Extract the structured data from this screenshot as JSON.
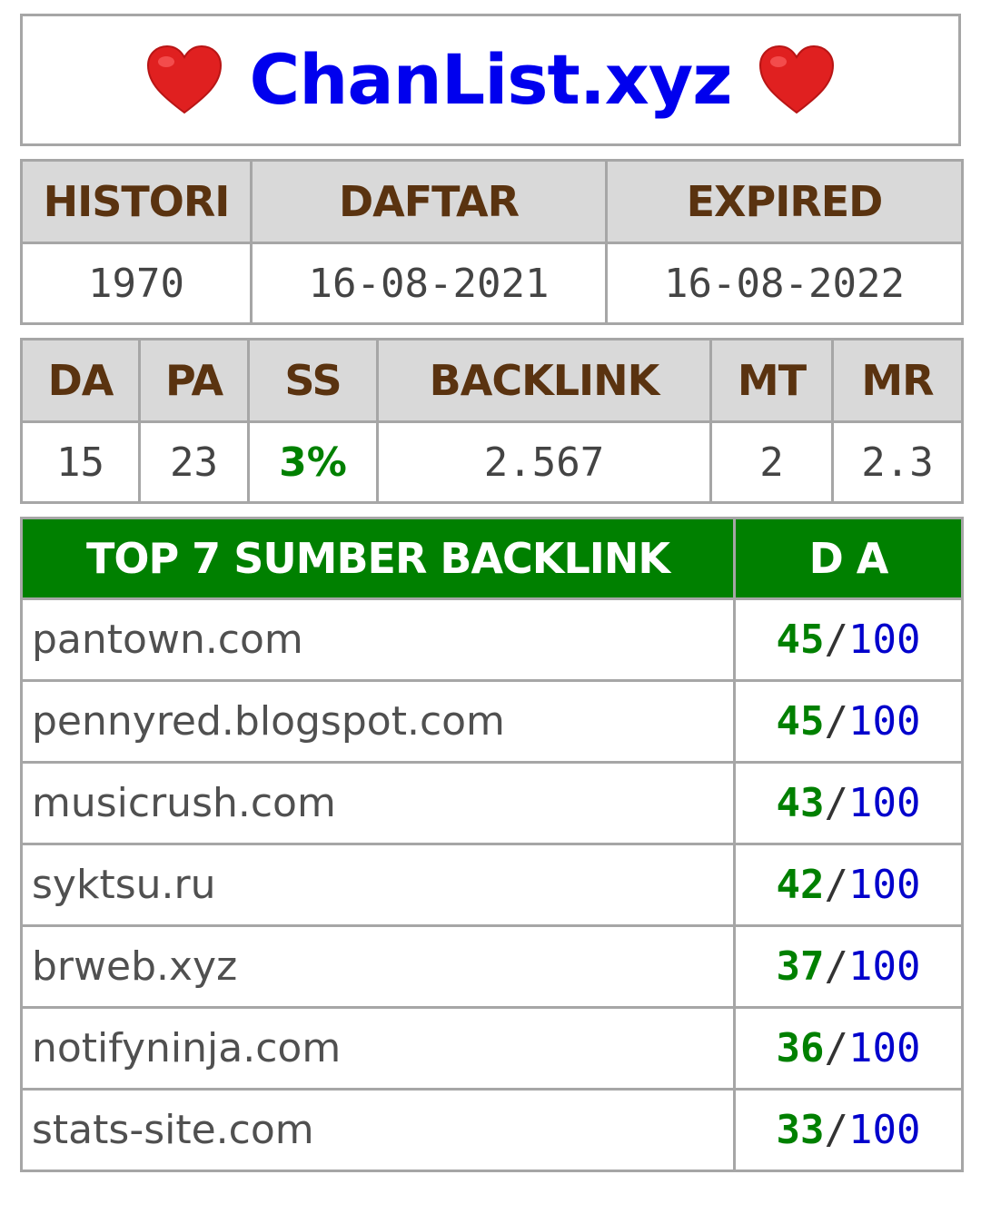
{
  "title": {
    "text": "ChanList.xyz",
    "left_icon": "heart-icon",
    "right_icon": "heart-icon",
    "title_color": "#0000ee",
    "heart_color": "#e02020"
  },
  "dates": {
    "headers": [
      "HISTORI",
      "DAFTAR",
      "EXPIRED"
    ],
    "values": [
      "1970",
      "16-08-2021",
      "16-08-2022"
    ]
  },
  "metrics": {
    "headers": [
      "DA",
      "PA",
      "SS",
      "BACKLINK",
      "MT",
      "MR"
    ],
    "values": [
      "15",
      "23",
      "3%",
      "2.567",
      "2",
      "2.3"
    ]
  },
  "backlinks": {
    "header_source": "TOP 7 SUMBER BACKLINK",
    "header_da": "D A",
    "header_color": "#008000",
    "separator": "/",
    "rows": [
      {
        "source": "pantown.com",
        "da": "45",
        "max": "100"
      },
      {
        "source": "pennyred.blogspot.com",
        "da": "45",
        "max": "100"
      },
      {
        "source": "musicrush.com",
        "da": "43",
        "max": "100"
      },
      {
        "source": "syktsu.ru",
        "da": "42",
        "max": "100"
      },
      {
        "source": "brweb.xyz",
        "da": "37",
        "max": "100"
      },
      {
        "source": "notifyninja.com",
        "da": "36",
        "max": "100"
      },
      {
        "source": "stats-site.com",
        "da": "33",
        "max": "100"
      }
    ]
  }
}
